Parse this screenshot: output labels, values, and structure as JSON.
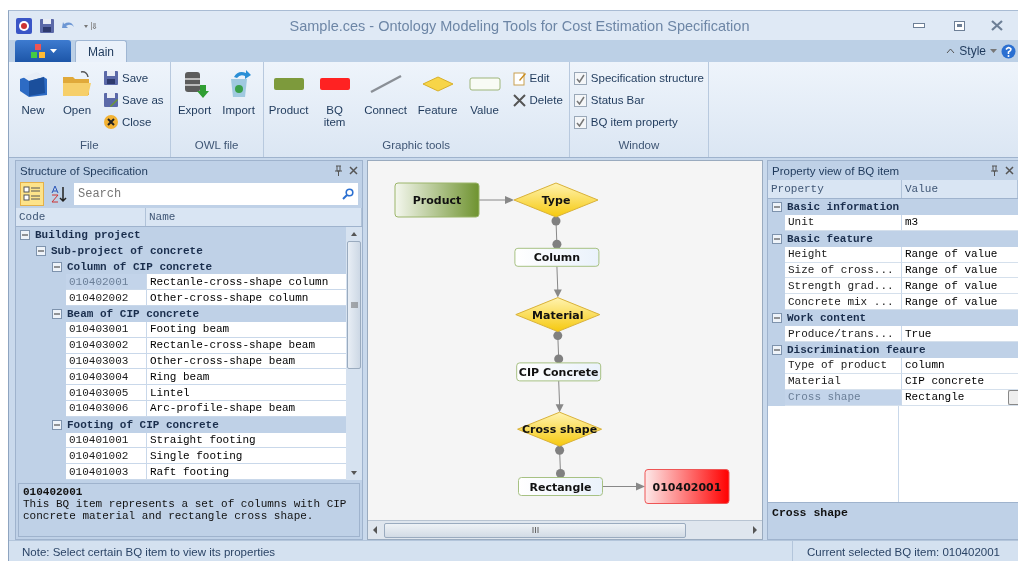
{
  "window": {
    "title": "Sample.ces - Ontology Modeling Tools for Cost Estimation Specification"
  },
  "ribbon": {
    "tabs": [
      {
        "label": "Main",
        "selected": true
      }
    ],
    "style_menu": "Style",
    "groups": [
      {
        "label": "File",
        "items": [
          {
            "kind": "large",
            "label": "New"
          },
          {
            "kind": "large",
            "label": "Open"
          },
          {
            "kind": "small",
            "label": "Save"
          },
          {
            "kind": "small",
            "label": "Save as"
          },
          {
            "kind": "small",
            "label": "Close"
          }
        ]
      },
      {
        "label": "OWL file",
        "items": [
          {
            "kind": "large",
            "label": "Export"
          },
          {
            "kind": "large",
            "label": "Import"
          }
        ]
      },
      {
        "label": "Graphic tools",
        "items": [
          {
            "kind": "large",
            "label": "Product"
          },
          {
            "kind": "large",
            "label": "BQ item"
          },
          {
            "kind": "large",
            "label": "Connect"
          },
          {
            "kind": "large",
            "label": "Feature"
          },
          {
            "kind": "large",
            "label": "Value"
          },
          {
            "kind": "small",
            "label": "Edit"
          },
          {
            "kind": "small",
            "label": "Delete"
          }
        ]
      },
      {
        "label": "Window",
        "items": [
          {
            "kind": "check",
            "label": "Specification structure",
            "checked": true
          },
          {
            "kind": "check",
            "label": "Status Bar",
            "checked": true
          },
          {
            "kind": "check",
            "label": "BQ item property",
            "checked": true
          }
        ]
      }
    ]
  },
  "structure_panel": {
    "title": "Structure of Specification",
    "search": {
      "placeholder": "Search"
    },
    "columns": [
      "Code",
      "Name"
    ],
    "tree": [
      {
        "label": "Building project",
        "expanded": true,
        "children": [
          {
            "label": "Sub-project of concrete",
            "expanded": true,
            "children": [
              {
                "label": "Column of CIP concrete",
                "expanded": true,
                "items": [
                  {
                    "code": "010402001",
                    "name": "Rectanle-cross-shape column",
                    "selected": true
                  },
                  {
                    "code": "010402002",
                    "name": "Other-cross-shape column",
                    "selected": false
                  }
                ]
              },
              {
                "label": "Beam of CIP concrete",
                "expanded": true,
                "items": [
                  {
                    "code": "010403001",
                    "name": "Footing beam",
                    "selected": false
                  },
                  {
                    "code": "010403002",
                    "name": "Rectanle-cross-shape beam",
                    "selected": false
                  },
                  {
                    "code": "010403003",
                    "name": "Other-cross-shape beam",
                    "selected": false
                  },
                  {
                    "code": "010403004",
                    "name": "Ring beam",
                    "selected": false
                  },
                  {
                    "code": "010403005",
                    "name": "Lintel",
                    "selected": false
                  },
                  {
                    "code": "010403006",
                    "name": "Arc-profile-shape beam",
                    "selected": false
                  }
                ]
              },
              {
                "label": "Footing of CIP concrete",
                "expanded": true,
                "items": [
                  {
                    "code": "010401001",
                    "name": "Straight footing",
                    "selected": false
                  },
                  {
                    "code": "010401002",
                    "name": "Single footing",
                    "selected": false
                  },
                  {
                    "code": "010401003",
                    "name": "Raft footing",
                    "selected": false
                  }
                ]
              }
            ]
          }
        ]
      }
    ],
    "description": {
      "title": "010402001",
      "text": "This BQ item represents a set of columns with CIP concrete material and rectangle cross shape."
    }
  },
  "diagram": {
    "nodes": [
      {
        "kind": "product",
        "label": "Product"
      },
      {
        "kind": "feature",
        "label": "Type"
      },
      {
        "kind": "value",
        "label": "Column"
      },
      {
        "kind": "feature",
        "label": "Material"
      },
      {
        "kind": "value",
        "label": "CIP Concrete"
      },
      {
        "kind": "feature",
        "label": "Cross shape"
      },
      {
        "kind": "value",
        "label": "Rectangle"
      },
      {
        "kind": "bq",
        "label": "010402001"
      }
    ]
  },
  "property_panel": {
    "title": "Property view of BQ item",
    "columns": [
      "Property",
      "Value"
    ],
    "categories": [
      {
        "label": "Basic information",
        "expanded": true,
        "rows": [
          {
            "property": "Unit",
            "value": "m3",
            "selected": false
          }
        ]
      },
      {
        "label": "Basic feature",
        "expanded": true,
        "rows": [
          {
            "property": "Height",
            "value": "Range of value",
            "selected": false
          },
          {
            "property": "Size of cross...",
            "value": "Range of value",
            "selected": false
          },
          {
            "property": "Strength grad...",
            "value": "Range of value",
            "selected": false
          },
          {
            "property": "Concrete mix ...",
            "value": "Range of value",
            "selected": false
          }
        ]
      },
      {
        "label": "Work content",
        "expanded": true,
        "rows": [
          {
            "property": "Produce/trans...",
            "value": "True",
            "selected": false
          }
        ]
      },
      {
        "label": "Discrimination feaure",
        "expanded": true,
        "rows": [
          {
            "property": "Type of product",
            "value": "column",
            "selected": false
          },
          {
            "property": "Material",
            "value": "CIP concrete",
            "selected": false
          },
          {
            "property": "Cross shape",
            "value": "Rectangle",
            "selected": true
          }
        ]
      }
    ],
    "description": "Cross shape"
  },
  "status_bar": {
    "note": "Note: Select certain BQ item to view its properties",
    "current": "Current selected BQ item: 010402001"
  }
}
